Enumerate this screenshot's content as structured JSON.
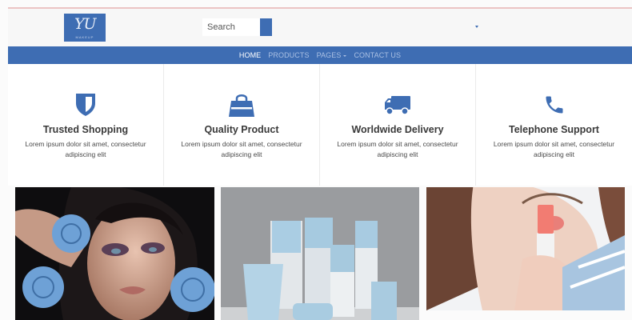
{
  "header": {
    "logo_text": "YU",
    "logo_subtext": "MAKEUP",
    "search_placeholder": "Search"
  },
  "nav": {
    "items": [
      {
        "label": "HOME",
        "active": true
      },
      {
        "label": "PRODUCTS"
      },
      {
        "label": "PAGES",
        "has_dropdown": true
      },
      {
        "label": "CONTACT US"
      }
    ]
  },
  "features": [
    {
      "icon": "shield-icon",
      "title": "Trusted Shopping",
      "text": "Lorem ipsum dolor sit amet, consectetur adipiscing elit"
    },
    {
      "icon": "shopping-bag-icon",
      "title": "Quality Product",
      "text": "Lorem ipsum dolor sit amet, consectetur adipiscing elit"
    },
    {
      "icon": "truck-icon",
      "title": "Worldwide Delivery",
      "text": "Lorem ipsum dolor sit amet, consectetur adipiscing elit"
    },
    {
      "icon": "phone-icon",
      "title": "Telephone Support",
      "text": "Lorem ipsum dolor sit amet, consectetur adipiscing elit"
    }
  ],
  "gallery": [
    {
      "subject": "woman with blue roses"
    },
    {
      "subject": "light blue skincare bottles"
    },
    {
      "subject": "woman applying lipstick"
    }
  ],
  "colors": {
    "brand": "#3e6db3",
    "nav_text": "#aac0e3",
    "top_rule": "#ecc4c4"
  }
}
